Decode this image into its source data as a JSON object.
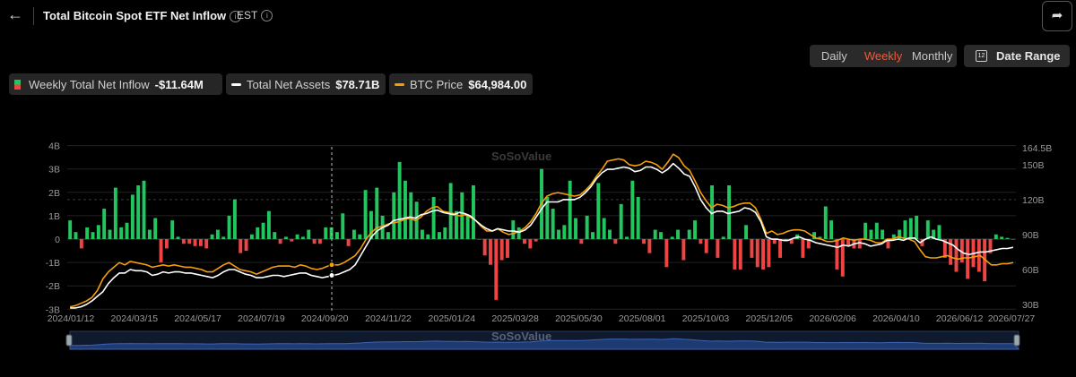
{
  "header": {
    "back_icon": "arrow-left-icon",
    "title": "Total Bitcoin Spot ETF Net Inflow",
    "info_icon": "i",
    "timezone": "EST",
    "tz_info_icon": "i",
    "share_icon": "share-icon"
  },
  "controls": {
    "periods": [
      "Daily",
      "Weekly",
      "Monthly"
    ],
    "active_period": "Weekly",
    "date_range_label": "Date Range",
    "calendar_icon": "12"
  },
  "legend": [
    {
      "label": "Weekly Total Net Inflow",
      "value": "-$11.64M",
      "color": "#22c55e"
    },
    {
      "label": "Total Net Assets",
      "value": "$78.71B",
      "color": "#ffffff"
    },
    {
      "label": "BTC Price",
      "value": "$64,984.00",
      "color": "#f59e0b"
    }
  ],
  "watermark": "SoSoValue",
  "colors": {
    "positive": "#22c55e",
    "negative": "#ef4444",
    "assets": "#ffffff",
    "price": "#f59e0b",
    "navigator": "#1e3a72"
  },
  "chart_data": {
    "type": "bar",
    "grid": true,
    "x_ticks": [
      "2024/01/12",
      "2024/03/15",
      "2024/05/17",
      "2024/07/19",
      "2024/09/20",
      "2024/11/22",
      "2025/01/24",
      "2025/03/28",
      "2025/05/30",
      "2025/08/01",
      "2025/10/03",
      "2025/12/05",
      "2026/02/06",
      "2026/04/10",
      "2026/06/12",
      "2026/07/27"
    ],
    "left_axis": {
      "ticks": [
        "4B",
        "3B",
        "2B",
        "1B",
        "0",
        "-1B",
        "-2B",
        "-3B"
      ],
      "ylim": [
        -3,
        4
      ],
      "unit": "B"
    },
    "right_axis": {
      "ticks": [
        "164.5B",
        "150B",
        "120B",
        "90B",
        "60B",
        "30B"
      ],
      "ylim": [
        30,
        164.5
      ],
      "unit": "B"
    },
    "x_start": "2024/01/12",
    "x_interval": "weekly",
    "series": [
      {
        "name": "Weekly Total Net Inflow",
        "axis": "left",
        "type": "bar",
        "values": [
          0.8,
          0.3,
          -0.4,
          0.5,
          0.3,
          0.6,
          1.3,
          0.4,
          2.2,
          0.5,
          0.7,
          1.9,
          2.3,
          2.5,
          0.4,
          0.9,
          -1.0,
          -0.4,
          0.8,
          0.1,
          -0.2,
          -0.2,
          -0.3,
          -0.3,
          -0.4,
          0.2,
          0.4,
          0.1,
          1.0,
          1.7,
          -0.6,
          -0.5,
          0.2,
          0.5,
          0.7,
          1.2,
          0.3,
          -0.2,
          0.1,
          -0.1,
          0.2,
          0.1,
          0.4,
          -0.2,
          -0.2,
          0.5,
          0.5,
          0.3,
          1.1,
          -0.3,
          0.4,
          0.2,
          2.1,
          1.2,
          2.2,
          1.0,
          0.3,
          2.0,
          3.3,
          2.5,
          2.0,
          1.6,
          0.4,
          0.2,
          1.8,
          0.3,
          0.5,
          2.4,
          1.2,
          2.0,
          1.0,
          2.3,
          0.0,
          -0.7,
          -1.1,
          -2.6,
          -0.9,
          -0.8,
          0.8,
          0.5,
          -0.2,
          -0.4,
          -0.1,
          3.0,
          1.8,
          1.3,
          0.4,
          0.6,
          2.5,
          0.9,
          -0.2,
          1.0,
          0.3,
          2.4,
          0.9,
          0.4,
          -0.2,
          1.5,
          0.1,
          2.5,
          1.8,
          -0.2,
          -0.6,
          0.4,
          0.3,
          -1.2,
          0.1,
          0.4,
          -0.9,
          0.4,
          0.8,
          -0.2,
          -0.6,
          2.3,
          -0.8,
          0.1,
          2.3,
          -1.3,
          -1.3,
          0.6,
          -0.8,
          -1.2,
          -1.3,
          -1.2,
          -0.2,
          -0.8,
          -0.1,
          -0.2,
          0.2,
          -0.8,
          -0.4,
          0.3,
          0.1,
          1.4,
          0.8,
          -1.3,
          -1.6,
          -0.3,
          -0.4,
          -0.4,
          0.7,
          0.4,
          0.7,
          0.4,
          -0.4,
          0.2,
          0.4,
          0.8,
          0.9,
          1.0,
          -0.3,
          0.8,
          0.4,
          0.6,
          -0.8,
          -1.1,
          -1.4,
          -1.0,
          -1.7,
          -1.2,
          -1.4,
          -1.8,
          -0.6,
          0.2,
          0.1,
          0.05,
          0.0
        ]
      },
      {
        "name": "Total Net Assets",
        "axis": "right",
        "type": "line",
        "values": [
          27,
          27,
          28,
          30,
          33,
          37,
          41,
          48,
          53,
          57,
          57,
          60,
          59,
          59,
          58,
          55,
          56,
          58,
          57,
          58,
          58,
          57,
          57,
          56,
          55,
          54,
          53,
          55,
          58,
          60,
          60,
          58,
          56,
          55,
          53,
          53,
          54,
          55,
          55,
          54,
          55,
          56,
          57,
          57,
          55,
          54,
          53,
          54,
          55,
          56,
          58,
          60,
          64,
          72,
          80,
          88,
          93,
          96,
          98,
          102,
          103,
          104,
          105,
          104,
          107,
          108,
          110,
          111,
          109,
          108,
          107,
          109,
          108,
          106,
          102,
          98,
          95,
          93,
          95,
          94,
          93,
          93,
          92,
          94,
          98,
          105,
          112,
          118,
          118,
          118,
          120,
          120,
          120,
          122,
          126,
          131,
          138,
          143,
          146,
          146,
          147,
          148,
          147,
          144,
          145,
          148,
          148,
          146,
          143,
          146,
          151,
          147,
          142,
          140,
          131,
          120,
          113,
          108,
          110,
          110,
          108,
          109,
          110,
          113,
          112,
          109,
          101,
          88,
          86,
          86,
          85,
          85,
          87,
          88,
          86,
          85,
          83,
          82,
          81,
          80,
          79,
          81,
          80,
          82,
          83,
          82,
          80,
          81,
          82,
          85,
          85,
          86,
          85,
          87,
          87,
          83,
          86,
          88,
          86,
          85,
          83,
          81,
          77,
          74,
          73,
          74,
          75,
          75,
          76,
          77,
          78,
          78,
          79
        ]
      },
      {
        "name": "BTC Price",
        "axis": "right",
        "type": "line",
        "values": [
          28,
          29,
          31,
          33,
          36,
          42,
          52,
          58,
          62,
          66,
          64,
          67,
          66,
          65,
          64,
          62,
          63,
          64,
          63,
          64,
          63,
          62,
          62,
          61,
          60,
          58,
          58,
          61,
          64,
          66,
          63,
          60,
          59,
          58,
          56,
          58,
          60,
          62,
          63,
          63,
          63,
          62,
          64,
          63,
          61,
          60,
          61,
          63,
          64,
          64,
          66,
          69,
          72,
          78,
          86,
          92,
          96,
          97,
          99,
          100,
          101,
          103,
          104,
          102,
          105,
          110,
          113,
          114,
          110,
          109,
          108,
          106,
          107,
          105,
          102,
          97,
          93,
          93,
          95,
          92,
          90,
          91,
          93,
          96,
          101,
          108,
          117,
          123,
          125,
          126,
          125,
          124,
          123,
          124,
          128,
          133,
          140,
          146,
          153,
          154,
          155,
          154,
          150,
          149,
          150,
          153,
          152,
          150,
          146,
          152,
          159,
          156,
          149,
          145,
          136,
          126,
          119,
          113,
          116,
          115,
          113,
          114,
          116,
          117,
          117,
          113,
          103,
          91,
          93,
          90,
          91,
          93,
          94,
          94,
          93,
          90,
          87,
          86,
          84,
          84,
          85,
          87,
          86,
          85,
          86,
          86,
          85,
          83,
          83,
          86,
          86,
          88,
          87,
          86,
          84,
          77,
          71,
          70,
          70,
          71,
          72,
          70,
          69,
          70,
          70,
          71,
          72,
          68,
          64,
          64,
          65,
          65,
          66
        ]
      }
    ]
  }
}
